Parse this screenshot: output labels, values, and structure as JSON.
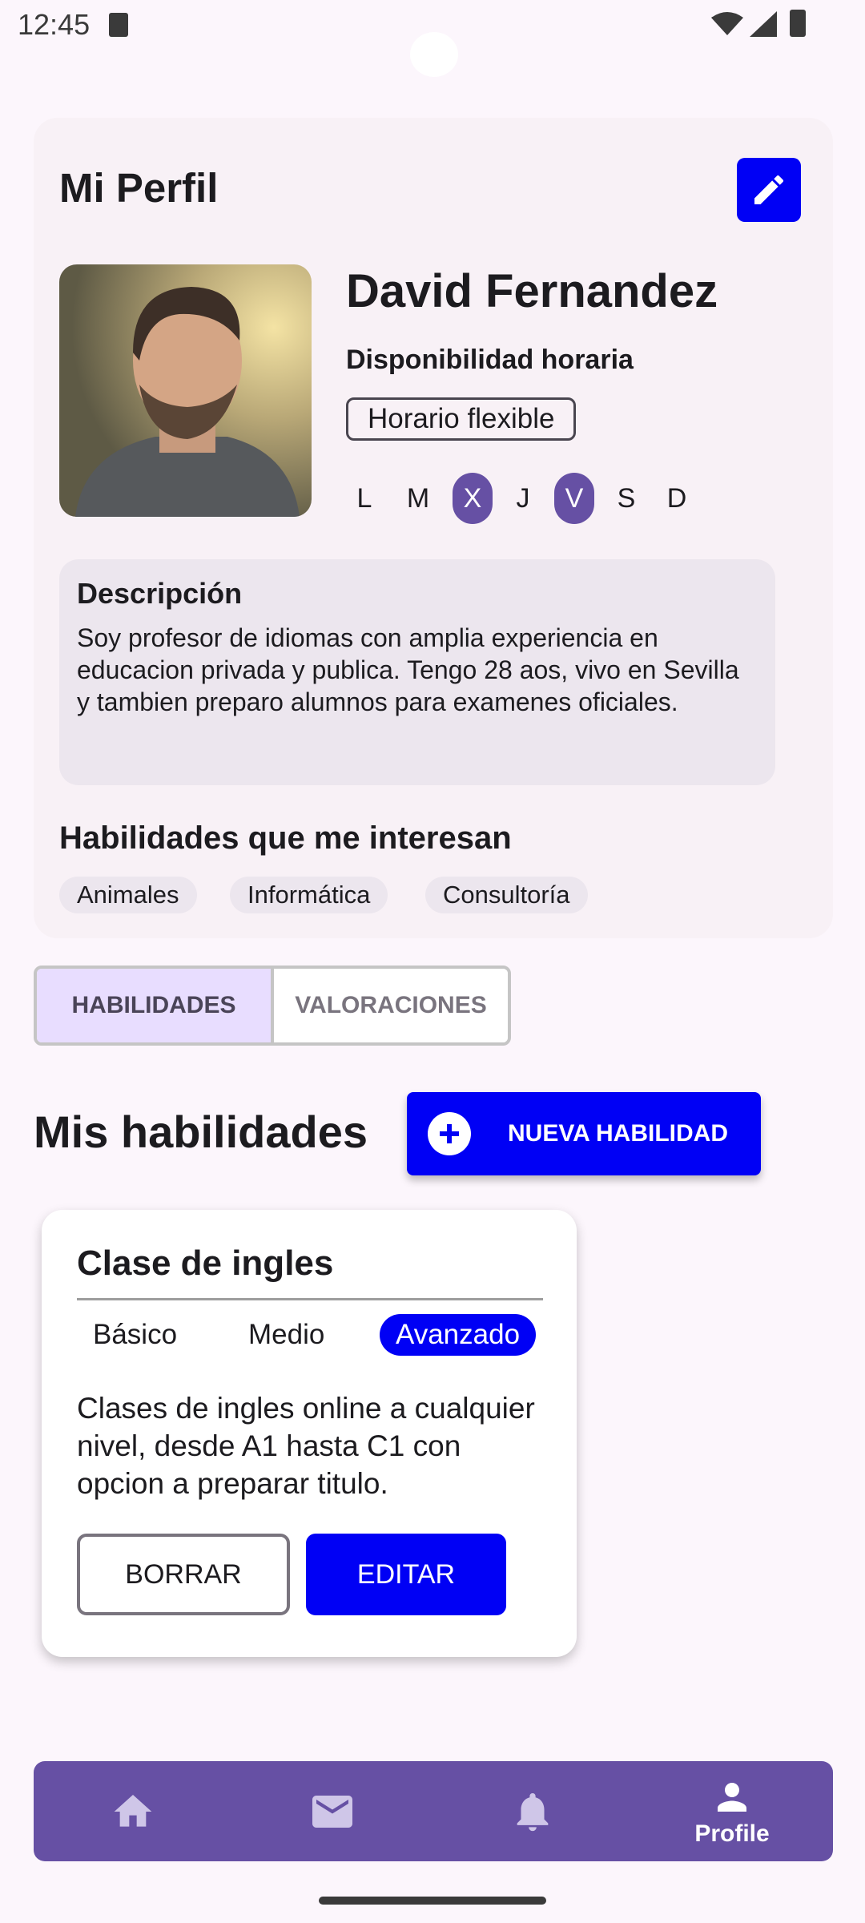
{
  "status_bar": {
    "time": "12:45"
  },
  "profile": {
    "title": "Mi Perfil",
    "name": "David Fernandez",
    "availability_label": "Disponibilidad horaria",
    "schedule": "Horario flexible",
    "days": [
      "L",
      "M",
      "X",
      "J",
      "V",
      "S",
      "D"
    ],
    "selected_days": [
      "X",
      "V"
    ],
    "description_title": "Descripción",
    "description": "Soy profesor de idiomas con amplia experiencia en educacion privada y publica. Tengo 28 aos, vivo en Sevilla y tambien preparo alumnos para examenes oficiales.",
    "interests_title": "Habilidades que me interesan",
    "interests": [
      "Animales",
      "Informática",
      "Consultoría"
    ]
  },
  "tabs": [
    {
      "label": "HABILIDADES",
      "selected": true
    },
    {
      "label": "VALORACIONES",
      "selected": false
    }
  ],
  "skills_section": {
    "title": "Mis habilidades",
    "new_button": "NUEVA HABILIDAD"
  },
  "skill_card": {
    "title": "Clase de ingles",
    "levels": [
      "Básico",
      "Medio",
      "Avanzado"
    ],
    "selected_level": "Avanzado",
    "description": "Clases de ingles online a cualquier nivel, desde A1 hasta C1 con opcion a preparar titulo.",
    "delete_button": "BORRAR",
    "edit_button": "EDITAR"
  },
  "bottom_nav": {
    "items": [
      {
        "icon": "home-icon"
      },
      {
        "icon": "mail-icon"
      },
      {
        "icon": "bell-icon"
      },
      {
        "icon": "person-icon",
        "label": "Profile",
        "active": true
      }
    ]
  },
  "colors": {
    "primary_blue": "#0000f5",
    "purple": "#6650a4",
    "tab_selected_bg": "#e8ddff"
  }
}
